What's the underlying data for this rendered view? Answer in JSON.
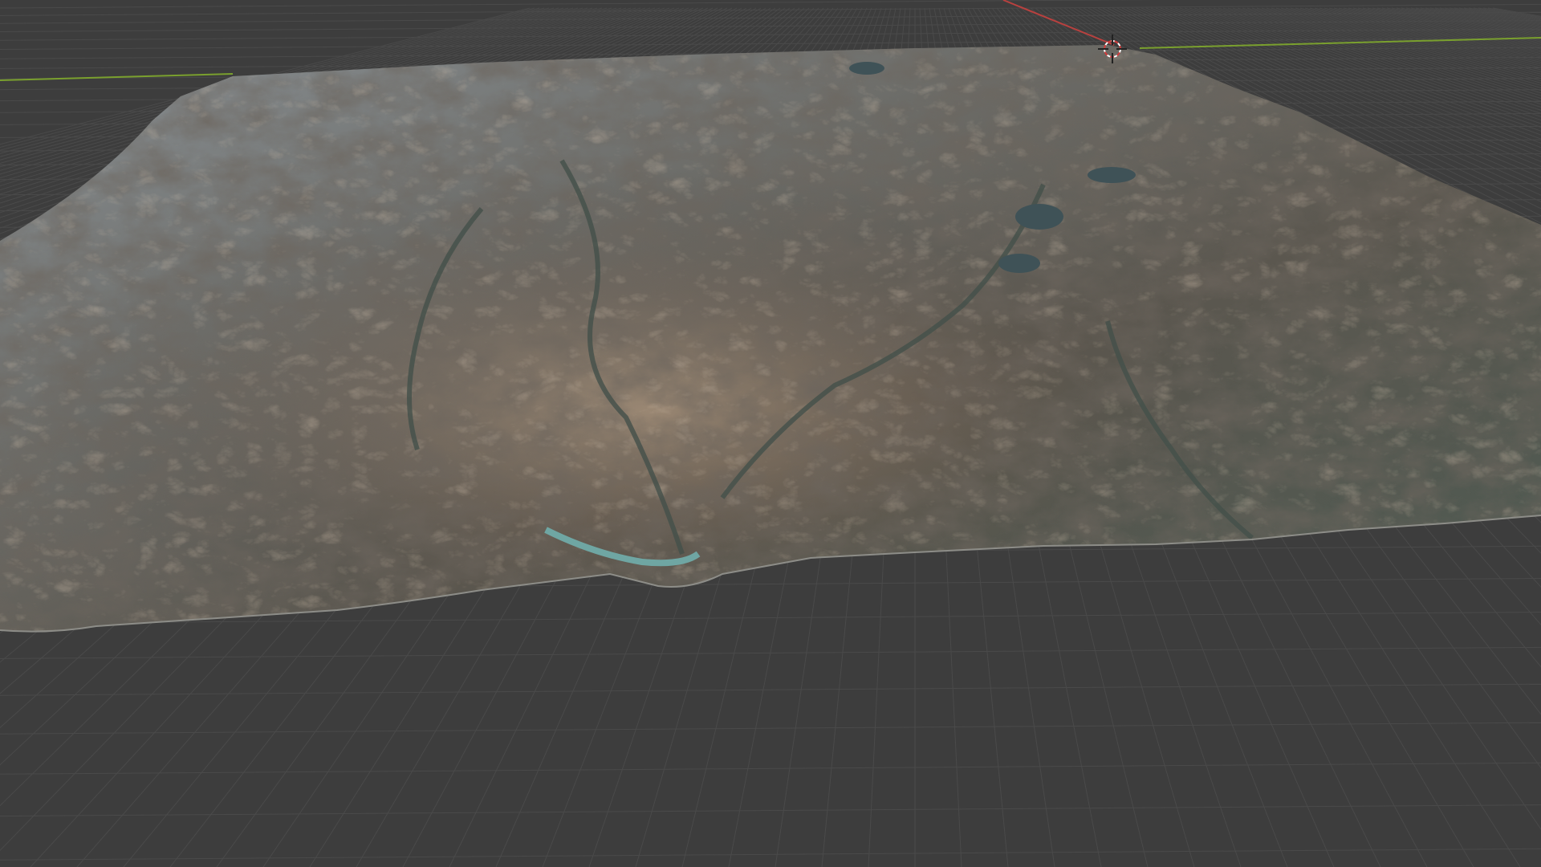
{
  "app": {
    "name": "",
    "view": "3D Viewport",
    "shading": "material-preview"
  },
  "viewport": {
    "background_color": "#3d3d3d",
    "grid_color": "#4a4a4a",
    "x_axis_color": "#b8413f",
    "y_axis_color": "#7aa02e",
    "cursor_icon": "3d-cursor-icon",
    "object": {
      "type": "terrain-mesh",
      "texture_palette": {
        "lowland": "#6e757a",
        "mid": "#5d5a52",
        "ridge": "#8a7058",
        "highlight": "#c9a98a",
        "valley": "#44504a",
        "water": "#3f5257",
        "glacier_lake": "#6fa6a3"
      }
    }
  }
}
